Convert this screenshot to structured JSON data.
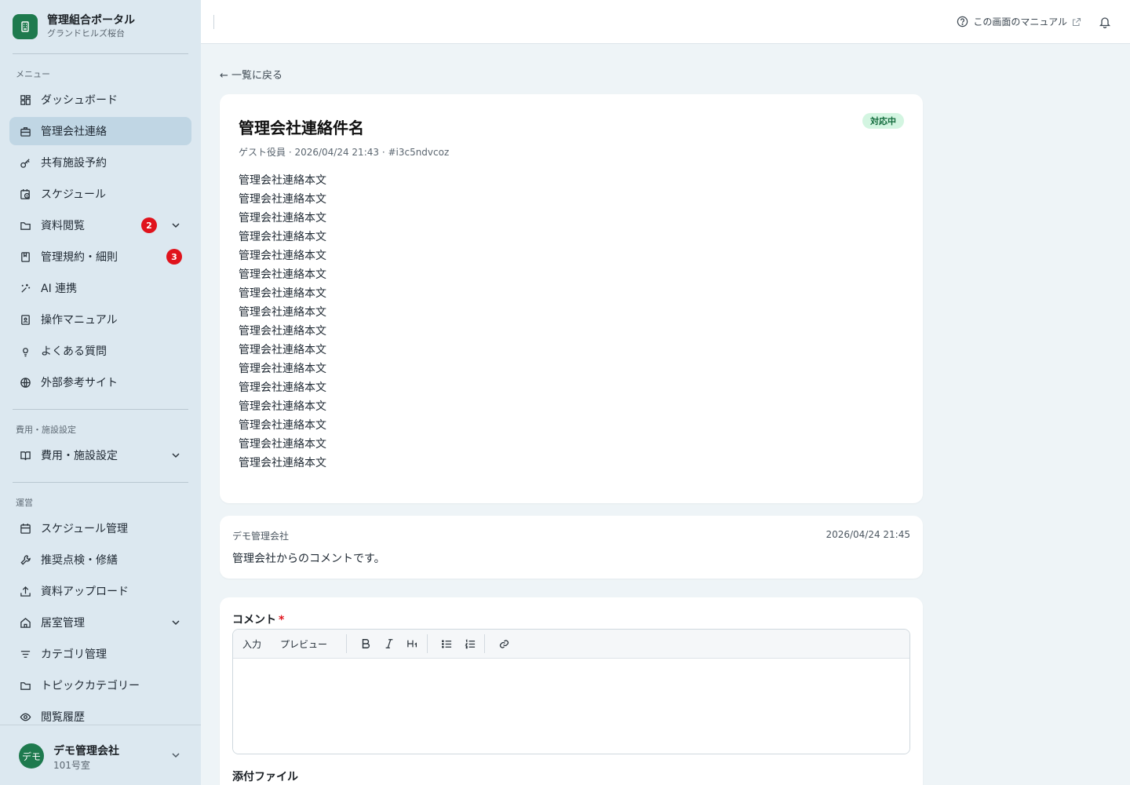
{
  "brand": {
    "title": "管理組合ポータル",
    "subtitle": "グランドヒルズ桜台"
  },
  "sidebar": {
    "sections": [
      {
        "label": "メニュー"
      },
      {
        "label": "費用・施設設定"
      },
      {
        "label": "運営"
      }
    ],
    "items": [
      {
        "label": "ダッシュボード",
        "icon": "dashboard-icon"
      },
      {
        "label": "管理会社連絡",
        "icon": "briefcase-icon",
        "active": true
      },
      {
        "label": "共有施設予約",
        "icon": "key-icon"
      },
      {
        "label": "スケジュール",
        "icon": "calendar-clock-icon"
      },
      {
        "label": "資料閲覧",
        "icon": "folder-icon",
        "badge": "2"
      },
      {
        "label": "管理規約・細則",
        "icon": "book-icon",
        "badge": "3"
      },
      {
        "label": "AI 連携",
        "icon": "sparkle-icon"
      },
      {
        "label": "操作マニュアル",
        "icon": "manual-icon"
      },
      {
        "label": "よくある質問",
        "icon": "lightbulb-icon"
      },
      {
        "label": "外部参考サイト",
        "icon": "globe-icon"
      },
      {
        "label": "費用・施設設定",
        "icon": "open-book-icon"
      },
      {
        "label": "スケジュール管理",
        "icon": "calendar-icon"
      },
      {
        "label": "推奨点検・修繕",
        "icon": "wrench-icon"
      },
      {
        "label": "資料アップロード",
        "icon": "upload-icon"
      },
      {
        "label": "居室管理",
        "icon": "home-icon"
      },
      {
        "label": "カテゴリ管理",
        "icon": "filter-icon"
      },
      {
        "label": "トピックカテゴリー",
        "icon": "folder-icon"
      },
      {
        "label": "閲覧履歴",
        "icon": "eye-icon"
      }
    ]
  },
  "user": {
    "avatar": "デモ",
    "name": "デモ管理会社",
    "room": "101号室"
  },
  "topbar": {
    "manual_label": "この画面のマニュアル"
  },
  "page": {
    "back_label": "← 一覧に戻る",
    "title": "管理会社連絡件名",
    "status": "対応中",
    "meta": "ゲスト役員 · 2026/04/24 21:43 · #i3c5ndvcoz",
    "body_lines": [
      "管理会社連絡本文",
      "管理会社連絡本文",
      "管理会社連絡本文",
      "管理会社連絡本文",
      "管理会社連絡本文",
      "管理会社連絡本文",
      "管理会社連絡本文",
      "管理会社連絡本文",
      "管理会社連絡本文",
      "管理会社連絡本文",
      "管理会社連絡本文",
      "管理会社連絡本文",
      "管理会社連絡本文",
      "管理会社連絡本文",
      "管理会社連絡本文",
      "管理会社連絡本文"
    ]
  },
  "comment": {
    "author": "デモ管理会社",
    "time": "2026/04/24 21:45",
    "body": "管理会社からのコメントです。"
  },
  "form": {
    "label": "コメント",
    "required_mark": "*",
    "tab_input": "入力",
    "tab_preview": "プレビュー",
    "textarea_value": "",
    "attach_label": "添付ファイル"
  },
  "colors": {
    "brand": "#1e7a4e",
    "badge": "#e0131c",
    "status_bg": "#d3f5e1",
    "status_text": "#126b3c"
  }
}
